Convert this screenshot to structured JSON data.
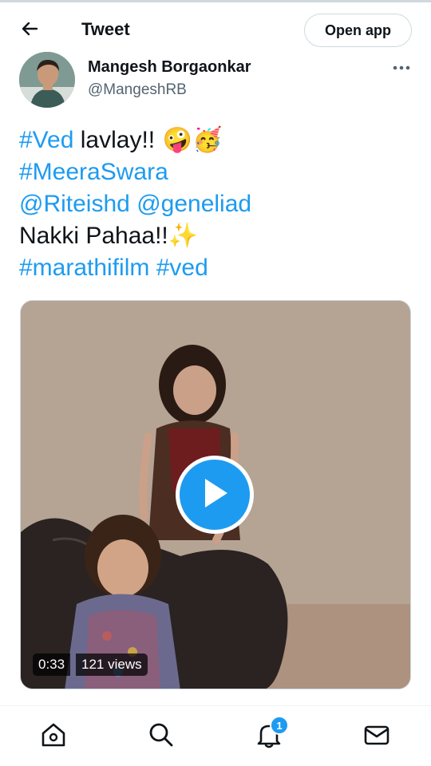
{
  "header": {
    "title": "Tweet",
    "open_app_label": "Open app",
    "back_icon": "arrow-left-icon"
  },
  "author": {
    "name": "Mangesh Borgaonkar",
    "handle": "@MangeshRB",
    "more_icon": "ellipsis-icon"
  },
  "tweet": {
    "line1": {
      "hashtag": "#Ved",
      "text": " lavlay!!",
      "emoji": " 🤪🥳"
    },
    "line2": {
      "hashtag": "#MeeraSwara"
    },
    "line3": {
      "mention1": "@Riteishd",
      "mention2": "@geneliad"
    },
    "line4": {
      "text": "Nakki Pahaa!!",
      "emoji": "✨"
    },
    "line5": {
      "hashtag1": "#marathifilm",
      "hashtag2": "#ved"
    }
  },
  "media": {
    "duration": "0:33",
    "views": "121 views",
    "play_icon": "play-icon"
  },
  "bottom_nav": {
    "items": [
      {
        "name": "home",
        "icon": "home-icon"
      },
      {
        "name": "explore",
        "icon": "search-icon"
      },
      {
        "name": "notifications",
        "icon": "bell-icon",
        "badge": "1"
      },
      {
        "name": "messages",
        "icon": "mail-icon"
      }
    ]
  },
  "colors": {
    "accent": "#1d9bf0",
    "text": "#0f1419",
    "secondary_text": "#536471",
    "border": "#cfd9de"
  }
}
